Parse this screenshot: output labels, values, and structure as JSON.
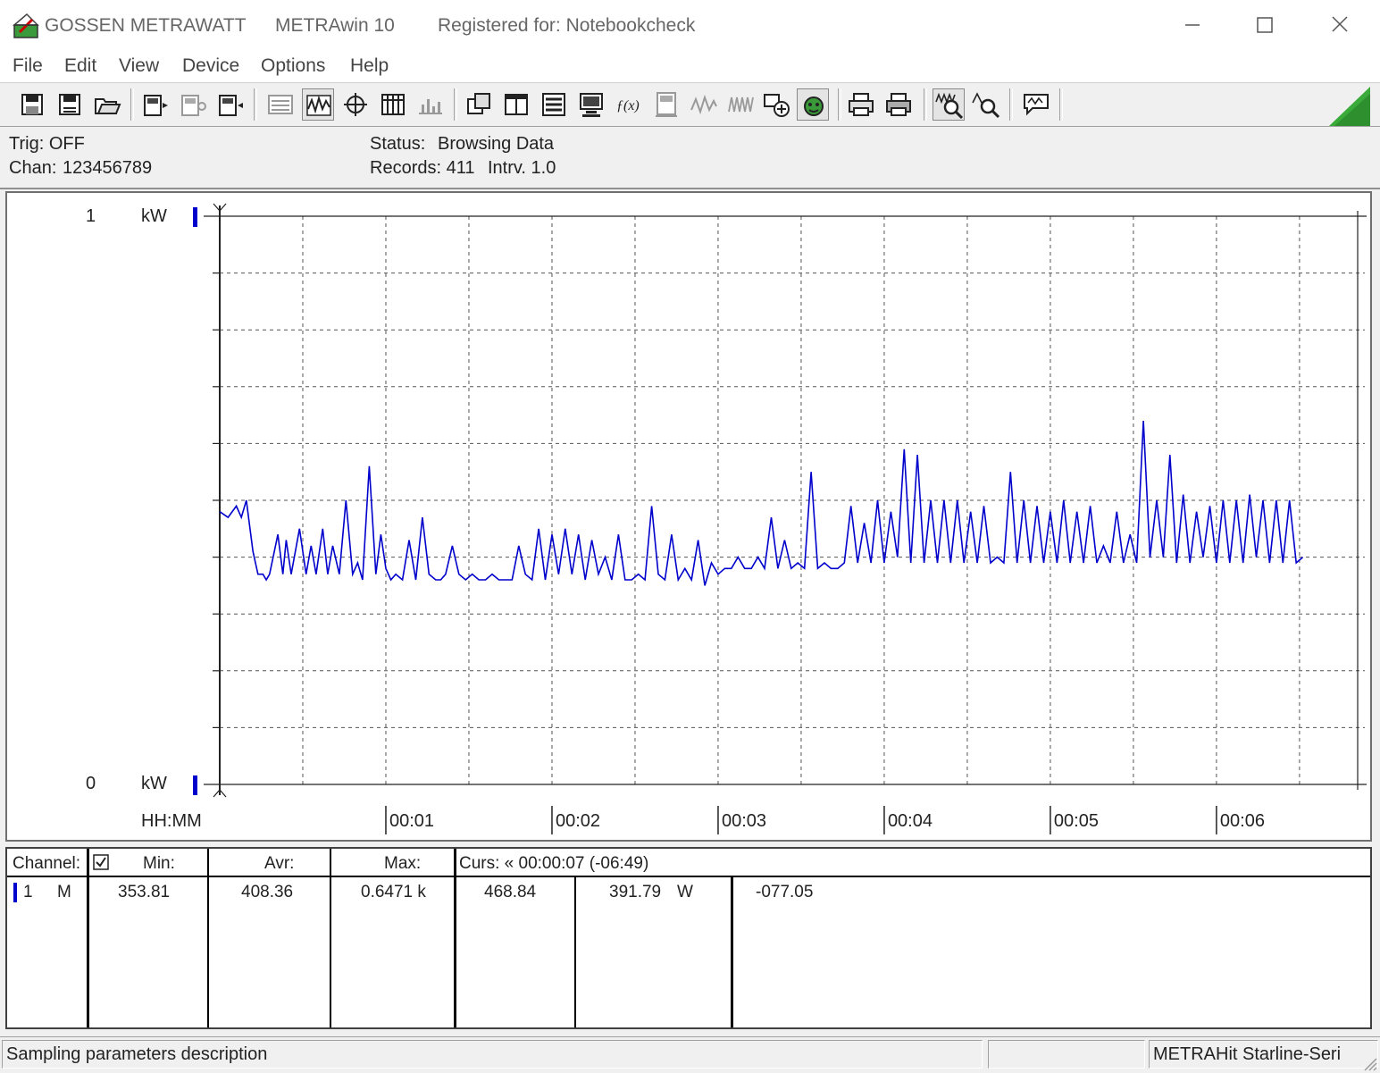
{
  "window": {
    "brand": "GOSSEN METRAWATT",
    "app_title": "METRAwin 10",
    "registration": "Registered for: Notebookcheck"
  },
  "menu": [
    "File",
    "Edit",
    "View",
    "Device",
    "Options",
    "Help"
  ],
  "toolbar": {
    "icons": [
      "save-icon",
      "save-as-icon",
      "open-icon",
      "device-read-icon",
      "device-config-icon",
      "device-send-icon",
      "list-view-icon",
      "trace-view-icon",
      "xy-view-icon",
      "table-view-icon",
      "histogram-view-icon",
      "window-arrange-icon",
      "window-tile-icon",
      "channel-list-icon",
      "monitor-icon",
      "math-function-icon",
      "meter-icon",
      "signal-icon",
      "waveform-icon",
      "link-icon",
      "status-icon",
      "print-icon",
      "print-setup-icon",
      "zoom-icon",
      "zoom-out-icon",
      "comment-icon"
    ]
  },
  "info": {
    "trig_label": "Trig: OFF",
    "chan_label": "Chan:",
    "chan_value": "123456789",
    "status_label": "Status:",
    "status_value": "Browsing Data",
    "records_label": "Records: 411",
    "interval_label": "Intrv. 1.0"
  },
  "colors": {
    "series": "#0000cc",
    "grid": "#555555"
  },
  "chart_data": {
    "type": "line",
    "ylim": [
      0,
      1
    ],
    "y_top_label": "1",
    "y_bottom_label": "0",
    "y_unit": "kW",
    "xlabel": "HH:MM",
    "x_ticks": [
      "00:01",
      "00:02",
      "00:03",
      "00:04",
      "00:05",
      "00:06"
    ],
    "xlim_minutes": [
      0,
      6.85
    ],
    "grid": true,
    "series": [
      {
        "x_minutes": [
          0,
          0.05,
          0.1,
          0.13,
          0.16,
          0.2,
          0.23,
          0.26,
          0.28,
          0.3,
          0.35,
          0.38,
          0.4,
          0.43,
          0.48,
          0.52,
          0.55,
          0.58,
          0.62,
          0.65,
          0.68,
          0.72,
          0.76,
          0.8,
          0.83,
          0.86,
          0.9,
          0.94,
          0.97,
          1,
          1.03,
          1.06,
          1.1,
          1.14,
          1.18,
          1.22,
          1.26,
          1.3,
          1.33,
          1.36,
          1.4,
          1.44,
          1.48,
          1.52,
          1.56,
          1.6,
          1.64,
          1.68,
          1.72,
          1.76,
          1.8,
          1.84,
          1.88,
          1.92,
          1.96,
          2,
          2.04,
          2.08,
          2.12,
          2.16,
          2.2,
          2.24,
          2.28,
          2.32,
          2.36,
          2.4,
          2.44,
          2.48,
          2.52,
          2.56,
          2.6,
          2.64,
          2.68,
          2.72,
          2.76,
          2.8,
          2.84,
          2.88,
          2.92,
          2.96,
          3,
          3.04,
          3.08,
          3.12,
          3.16,
          3.2,
          3.24,
          3.28,
          3.32,
          3.36,
          3.4,
          3.44,
          3.48,
          3.52,
          3.56,
          3.6,
          3.64,
          3.68,
          3.72,
          3.76,
          3.8,
          3.84,
          3.88,
          3.92,
          3.96,
          4,
          4.04,
          4.08,
          4.12,
          4.16,
          4.2,
          4.24,
          4.28,
          4.32,
          4.36,
          4.4,
          4.44,
          4.48,
          4.52,
          4.56,
          4.6,
          4.64,
          4.68,
          4.72,
          4.76,
          4.8,
          4.84,
          4.88,
          4.92,
          4.96,
          5,
          5.04,
          5.08,
          5.12,
          5.16,
          5.2,
          5.24,
          5.28,
          5.32,
          5.36,
          5.4,
          5.44,
          5.48,
          5.52,
          5.56,
          5.6,
          5.64,
          5.68,
          5.72,
          5.76,
          5.8,
          5.84,
          5.88,
          5.92,
          5.96,
          6,
          6.04,
          6.08,
          6.12,
          6.16,
          6.2,
          6.24,
          6.28,
          6.32,
          6.36,
          6.4,
          6.44,
          6.48,
          6.52,
          6.56,
          6.6,
          6.64,
          6.68,
          6.72,
          6.76,
          6.8,
          6.85
        ],
        "y_kw": [
          0.48,
          0.47,
          0.49,
          0.47,
          0.5,
          0.41,
          0.37,
          0.37,
          0.36,
          0.37,
          0.44,
          0.37,
          0.43,
          0.37,
          0.45,
          0.37,
          0.42,
          0.37,
          0.45,
          0.37,
          0.42,
          0.37,
          0.5,
          0.37,
          0.39,
          0.36,
          0.56,
          0.37,
          0.44,
          0.38,
          0.36,
          0.37,
          0.36,
          0.43,
          0.36,
          0.47,
          0.37,
          0.36,
          0.36,
          0.37,
          0.42,
          0.37,
          0.36,
          0.37,
          0.36,
          0.36,
          0.37,
          0.36,
          0.36,
          0.36,
          0.42,
          0.37,
          0.36,
          0.45,
          0.36,
          0.44,
          0.37,
          0.45,
          0.37,
          0.44,
          0.36,
          0.43,
          0.37,
          0.4,
          0.36,
          0.44,
          0.36,
          0.36,
          0.37,
          0.36,
          0.49,
          0.37,
          0.36,
          0.44,
          0.36,
          0.38,
          0.36,
          0.43,
          0.35,
          0.39,
          0.37,
          0.38,
          0.38,
          0.4,
          0.38,
          0.38,
          0.4,
          0.38,
          0.47,
          0.38,
          0.43,
          0.38,
          0.39,
          0.38,
          0.55,
          0.38,
          0.39,
          0.38,
          0.38,
          0.39,
          0.49,
          0.39,
          0.46,
          0.39,
          0.5,
          0.39,
          0.48,
          0.4,
          0.59,
          0.39,
          0.58,
          0.39,
          0.5,
          0.39,
          0.5,
          0.39,
          0.5,
          0.39,
          0.48,
          0.39,
          0.49,
          0.39,
          0.4,
          0.39,
          0.55,
          0.39,
          0.5,
          0.39,
          0.49,
          0.39,
          0.48,
          0.39,
          0.5,
          0.39,
          0.48,
          0.39,
          0.49,
          0.39,
          0.42,
          0.39,
          0.48,
          0.39,
          0.44,
          0.39,
          0.64,
          0.4,
          0.5,
          0.4,
          0.58,
          0.39,
          0.51,
          0.39,
          0.48,
          0.4,
          0.49,
          0.39,
          0.5,
          0.39,
          0.5,
          0.39,
          0.51,
          0.4,
          0.5,
          0.39,
          0.5,
          0.39,
          0.5,
          0.39,
          0.4
        ]
      }
    ]
  },
  "table": {
    "headers": {
      "channel": "Channel:",
      "min": "Min:",
      "avr": "Avr:",
      "max": "Max:",
      "cursor": "Curs: « 00:00:07 (-06:49)"
    },
    "row": {
      "channel": "1",
      "mode": "M",
      "min": "353.81",
      "avr": "408.36",
      "max": "0.6471 k",
      "cursor_value1": "468.84",
      "cursor_value2": "391.79",
      "unit": "W",
      "diff": "-077.05"
    }
  },
  "statusbar": {
    "left": "Sampling parameters description",
    "right": "METRAHit Starline-Seri"
  }
}
